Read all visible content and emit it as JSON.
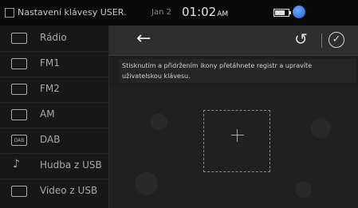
{
  "status": {
    "title": "Nastavení klávesy USER.",
    "date": "Jan 2",
    "time": "01:02",
    "ampm": "AM"
  },
  "sidebar": {
    "items": [
      {
        "label": "Rádio",
        "icon": "radio-icon"
      },
      {
        "label": "FM1",
        "icon": "radio-icon"
      },
      {
        "label": "FM2",
        "icon": "radio-icon"
      },
      {
        "label": "AM",
        "icon": "radio-icon"
      },
      {
        "label": "DAB",
        "icon": "dab-icon",
        "icon_text": "DAB"
      },
      {
        "label": "Hudba z USB",
        "icon": "music-note-icon"
      },
      {
        "label": "Video z USB",
        "icon": "video-icon"
      }
    ]
  },
  "main": {
    "instruction": "Stisknutím a přidržením ikony přetáhnete registr a upravíte uživatelskou klávesu."
  }
}
